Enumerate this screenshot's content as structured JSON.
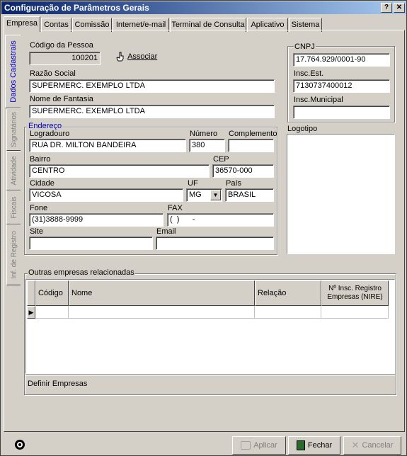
{
  "window": {
    "title": "Configuração de Parâmetros Gerais",
    "help_label": "?",
    "close_label": "✕"
  },
  "tabs": [
    "Empresa",
    "Contas",
    "Comissão",
    "Internet/e-mail",
    "Terminal de Consulta",
    "Aplicativo",
    "Sistema"
  ],
  "side_tabs": [
    "Dados Cadastrais",
    "Signatários",
    "Atividade",
    "Fiscais",
    "Inf. de Registro"
  ],
  "pessoa": {
    "label": "Código da Pessoa",
    "value": "100201",
    "associar_label": "Associar"
  },
  "razao_social": {
    "label": "Razão Social",
    "value": "SUPERMERC. EXEMPLO LTDA"
  },
  "nome_fantasia": {
    "label": "Nome de Fantasia",
    "value": "SUPERMERC. EXEMPLO LTDA"
  },
  "cnpj": {
    "label": "CNPJ",
    "value": "17.764.929/0001-90"
  },
  "insc_est": {
    "label": "Insc.Est.",
    "value": "7130737400012"
  },
  "insc_municipal": {
    "label": "Insc.Municipal",
    "value": ""
  },
  "logotipo": {
    "label": "Logotipo"
  },
  "endereco": {
    "legend": "Endereço",
    "logradouro": {
      "label": "Logradouro",
      "value": "RUA DR. MILTON BANDEIRA"
    },
    "numero": {
      "label": "Número",
      "value": "380"
    },
    "complemento": {
      "label": "Complemento",
      "value": ""
    },
    "bairro": {
      "label": "Bairro",
      "value": "CENTRO"
    },
    "cep": {
      "label": "CEP",
      "value": "36570-000"
    },
    "cidade": {
      "label": "Cidade",
      "value": "VICOSA"
    },
    "uf": {
      "label": "UF",
      "value": "MG"
    },
    "pais": {
      "label": "País",
      "value": "BRASIL"
    },
    "fone": {
      "label": "Fone",
      "value": "(31)3888-9999"
    },
    "fax": {
      "label": "FAX",
      "value": "(  )      -"
    },
    "site": {
      "label": "Site",
      "value": ""
    },
    "email": {
      "label": "Email",
      "value": ""
    }
  },
  "outras": {
    "legend": "Outras empresas relacionadas",
    "columns": [
      "Código",
      "Nome",
      "Relação",
      "Nº Insc. Registro Empresas (NIRE)"
    ],
    "row_indicator": "▶",
    "definir_label": "Definir Empresas"
  },
  "footer": {
    "aplicar": "Aplicar",
    "fechar": "Fechar",
    "cancelar": "Cancelar"
  },
  "colors": {
    "title_start": "#0a246a",
    "title_end": "#a6caf0",
    "face": "#d4d0c8",
    "active_side_tab_text": "#0000c0"
  }
}
